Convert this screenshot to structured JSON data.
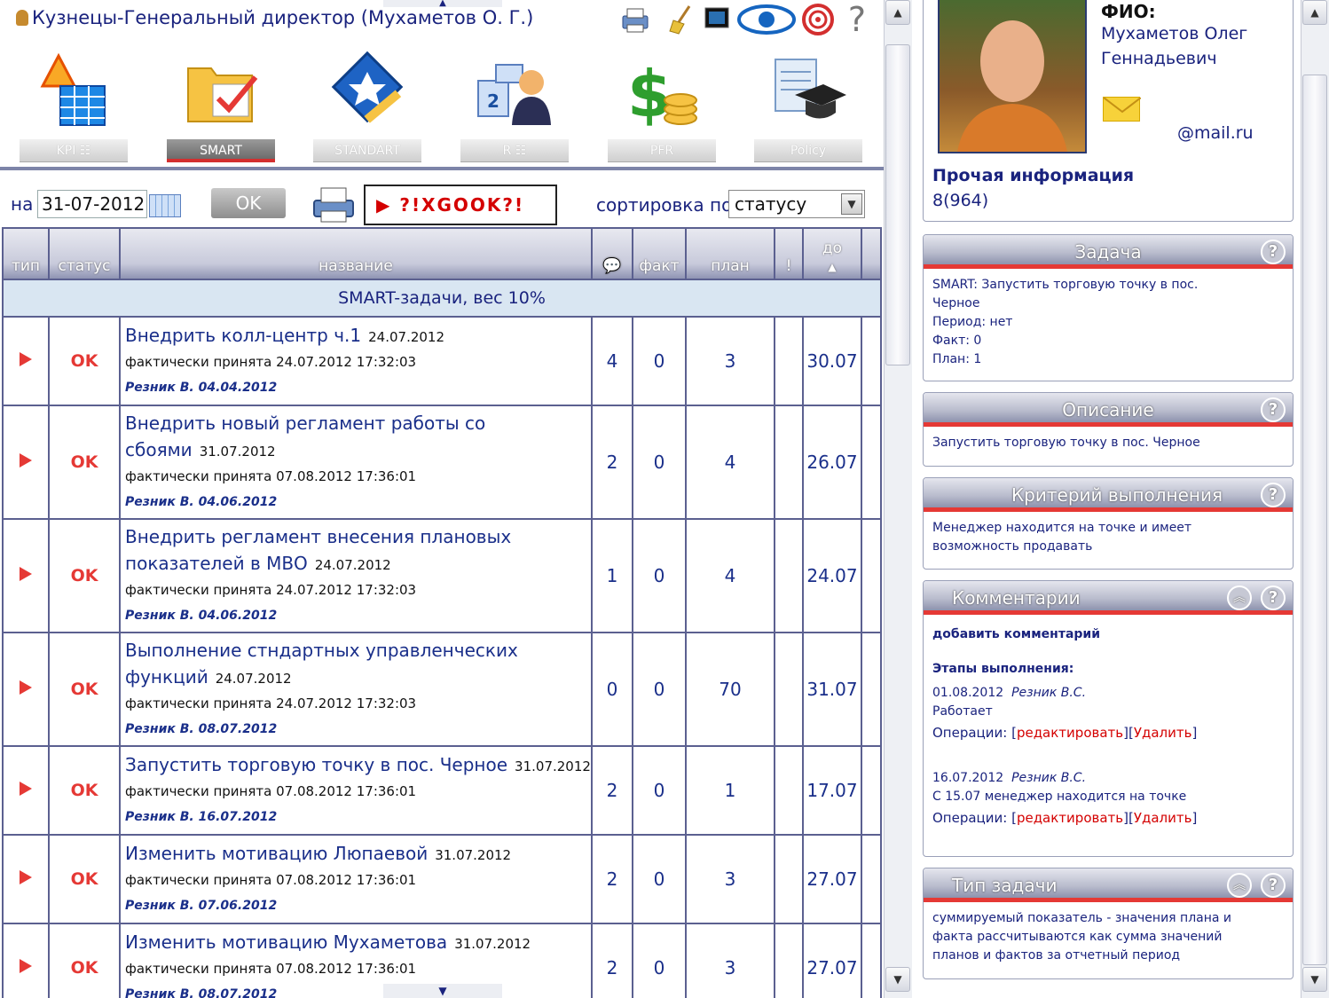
{
  "header": {
    "title": "Кузнецы-Генеральный директор   (Мухаметов О. Г.)",
    "tools": [
      "printer-icon",
      "broom-icon",
      "monitor-icon",
      "eye-icon",
      "target-icon",
      "help-icon"
    ],
    "help_glyph": "?"
  },
  "modules": [
    {
      "label": "KPI  ☷",
      "icon": "kpi-icon",
      "active": false
    },
    {
      "label": "SMART",
      "icon": "folder-check-icon",
      "active": true
    },
    {
      "label": "STANDART",
      "icon": "goal-icon",
      "active": false
    },
    {
      "label": "R  ☷",
      "icon": "ranking-icon",
      "active": false
    },
    {
      "label": "PFR",
      "icon": "dollar-icon",
      "active": false
    },
    {
      "label": "Policy",
      "icon": "diploma-icon",
      "active": false
    }
  ],
  "filter": {
    "date_label": "на",
    "date_value": "31-07-2012",
    "ok_label": "OK",
    "ticker_text": "?!XGOOK?!",
    "sort_label": "сортировка по",
    "sort_value": "статусу"
  },
  "table": {
    "headers": {
      "type": "тип",
      "status": "статус",
      "name": "название",
      "comment": "comment-icon",
      "fact": "факт",
      "plan": "план",
      "excl": "!",
      "due": "до"
    },
    "section_title": "SMART-задачи, вес 10%",
    "rows": [
      {
        "status": "OK",
        "name": "Внедрить колл-центр ч.1",
        "date": "24.07.2012",
        "accepted": "фактически принята 24.07.2012 17:32:03",
        "author": "Резник В. 04.04.2012",
        "comments": "4",
        "fact": "0",
        "plan": "3",
        "due": "30.07"
      },
      {
        "status": "OK",
        "name": "Внедрить новый регламент работы со сбоями",
        "date": "31.07.2012",
        "accepted": "фактически принята 07.08.2012 17:36:01",
        "author": "Резник В. 04.06.2012",
        "comments": "2",
        "fact": "0",
        "plan": "4",
        "due": "26.07"
      },
      {
        "status": "OK",
        "name": "Внедрить регламент внесения плановых показателей в МВО",
        "date": "24.07.2012",
        "accepted": "фактически принята 24.07.2012 17:32:03",
        "author": "Резник В. 04.06.2012",
        "comments": "1",
        "fact": "0",
        "plan": "4",
        "due": "24.07"
      },
      {
        "status": "OK",
        "name": "Выполнение стндартных управленческих функций",
        "date": "24.07.2012",
        "accepted": "фактически принята 24.07.2012 17:32:03",
        "author": "Резник В. 08.07.2012",
        "comments": "0",
        "fact": "0",
        "plan": "70",
        "due": "31.07"
      },
      {
        "status": "OK",
        "name": "Запустить торговую точку в пос. Черное",
        "date": "31.07.2012",
        "accepted": "фактически принята 07.08.2012 17:36:01",
        "author": "Резник В. 16.07.2012",
        "comments": "2",
        "fact": "0",
        "plan": "1",
        "due": "17.07"
      },
      {
        "status": "OK",
        "name": "Изменить мотивацию Люпаевой",
        "date": "31.07.2012",
        "accepted": "фактически принята 07.08.2012 17:36:01",
        "author": "Резник В. 07.06.2012",
        "comments": "2",
        "fact": "0",
        "plan": "3",
        "due": "27.07"
      },
      {
        "status": "OK",
        "name": "Изменить мотивацию Мухаметова",
        "date": "31.07.2012",
        "accepted": "фактически принята 07.08.2012 17:36:01",
        "author": "Резник В. 08.07.2012",
        "comments": "2",
        "fact": "0",
        "plan": "3",
        "due": "27.07"
      }
    ]
  },
  "profile": {
    "fio_label": "ФИО:",
    "fio_line1": "Мухаметов Олег",
    "fio_line2": "Геннадьевич",
    "email": "@mail.ru",
    "other_info_label": "Прочая информация",
    "other_info_value": "8(964)"
  },
  "task_card": {
    "title": "Задача",
    "line1": "SMART: Запустить торговую точку в пос.",
    "line2": "Черное",
    "line3": "Период: нет",
    "line4": "Факт: 0",
    "line5": "План: 1"
  },
  "description_card": {
    "title": "Описание",
    "text": "Запустить торговую точку в пос. Черное"
  },
  "criteria_card": {
    "title": "Критерий выполнения",
    "line1": "Менеджер находится на точке и имеет",
    "line2": "возможность продавать"
  },
  "comments_card": {
    "title": "Комментарии",
    "add_label": "добавить комментарий",
    "stages_label": "Этапы выполнения:",
    "ops_label": "Операции: [",
    "edit_label": "редактировать",
    "sep": "][",
    "delete_label": "Удалить",
    "close_bracket": "]",
    "entries": [
      {
        "date": "01.08.2012",
        "author": "Резник В.С.",
        "text": "Работает"
      },
      {
        "date": "16.07.2012",
        "author": "Резник В.С.",
        "text": "С 15.07 менеджер находится на точке"
      }
    ]
  },
  "type_card": {
    "title": "Тип задачи",
    "line1": "суммируемый показатель - значения плана и",
    "line2": "факта рассчитываются как сумма значений",
    "line3": "планов и фактов за отчетный период"
  },
  "colors": {
    "accent_red": "#e53935",
    "text_blue": "#1a237e",
    "section_bg": "#d9e6f2"
  }
}
